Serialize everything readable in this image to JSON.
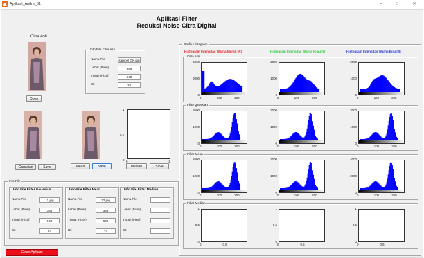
{
  "window": {
    "title": "Aplikasi_Andre_01",
    "minimize": "–",
    "maximize": "□",
    "close": "✕"
  },
  "header": {
    "line1": "Aplikasi Filter",
    "line2": "Reduksi Noise Citra Digital"
  },
  "citra_asli": {
    "label": "Citra Asli",
    "open_label": "Open"
  },
  "info_asli": {
    "title": "Info File Citra Asli",
    "rows": [
      {
        "label": "Nama File",
        "value": "sampel OK.jpg"
      },
      {
        "label": "Lebar (Pixel)",
        "value": "385"
      },
      {
        "label": "Tinggi (Pixel)",
        "value": "640"
      },
      {
        "label": "Bit",
        "value": "24"
      }
    ]
  },
  "filters": {
    "gaussian_label": "Gaussian",
    "mean_label": "Mean",
    "median_label": "Median",
    "save_label": "Save",
    "median_axis": {
      "y_ticks": [
        "1",
        "0.5",
        "0"
      ],
      "x_ticks": [
        "0",
        "1"
      ]
    }
  },
  "info_file": {
    "title": "Info File",
    "groups": [
      {
        "title": "Info File Filter Gaussian",
        "rows": [
          {
            "label": "Nama File",
            "value": "11.jpg"
          },
          {
            "label": "Lebar (Pixel)",
            "value": "385"
          },
          {
            "label": "Tinggi (Pixel)",
            "value": "640"
          },
          {
            "label": "Bit",
            "value": "24"
          }
        ]
      },
      {
        "title": "Info File Filter Mean",
        "rows": [
          {
            "label": "Nama File",
            "value": "22.jpg"
          },
          {
            "label": "Lebar (Pixel)",
            "value": "385"
          },
          {
            "label": "Tinggi (Pixel)",
            "value": "640"
          },
          {
            "label": "Bit",
            "value": "24"
          }
        ]
      },
      {
        "title": "Info File Filter Median",
        "rows": [
          {
            "label": "Nama File",
            "value": ""
          },
          {
            "label": "Lebar (Pixel)",
            "value": ""
          },
          {
            "label": "Tinggi (Pixel)",
            "value": ""
          },
          {
            "label": "Bit",
            "value": ""
          }
        ]
      }
    ]
  },
  "close_app_label": "Close Aplikasi",
  "grafik": {
    "title": "Grafik Histogram",
    "col_titles": [
      {
        "text": "Histogram Intensitas Warna Merah (R)",
        "color": "#e8202a"
      },
      {
        "text": "Histogram Intensitas Warna Hijau (G)",
        "color": "#2ecc40"
      },
      {
        "text": "Histogram Intensitas Warna Biru (B)",
        "color": "#2a3ad8"
      }
    ],
    "rows": [
      {
        "title": "Citra Asli",
        "y_ticks": [
          [
            "4000",
            "2000",
            "0"
          ],
          [
            "2000",
            "1000",
            "0"
          ],
          [
            "2000",
            "1000",
            "0"
          ]
        ]
      },
      {
        "title": "Filter gaussian",
        "y_ticks": [
          [
            "2000",
            "1000",
            "0"
          ],
          [
            "2000",
            "1000",
            "0"
          ],
          [
            "2000",
            "1000",
            "0"
          ]
        ]
      },
      {
        "title": "Filter Mean",
        "y_ticks": [
          [
            "2000",
            "1000",
            "0"
          ],
          [
            "2000",
            "1000",
            "0"
          ],
          [
            "4000",
            "2000",
            "0"
          ]
        ]
      },
      {
        "title": "Filter Median",
        "y_ticks": [
          [
            "1",
            "0.5",
            "0"
          ],
          [
            "1",
            "0.5",
            "0"
          ],
          [
            "1",
            "0.5",
            "0"
          ]
        ]
      }
    ],
    "x_ticks": [
      "0",
      "100",
      "200"
    ],
    "empty_x_ticks": [
      "0",
      "0.5"
    ],
    "bar_color": "#0000ff"
  }
}
